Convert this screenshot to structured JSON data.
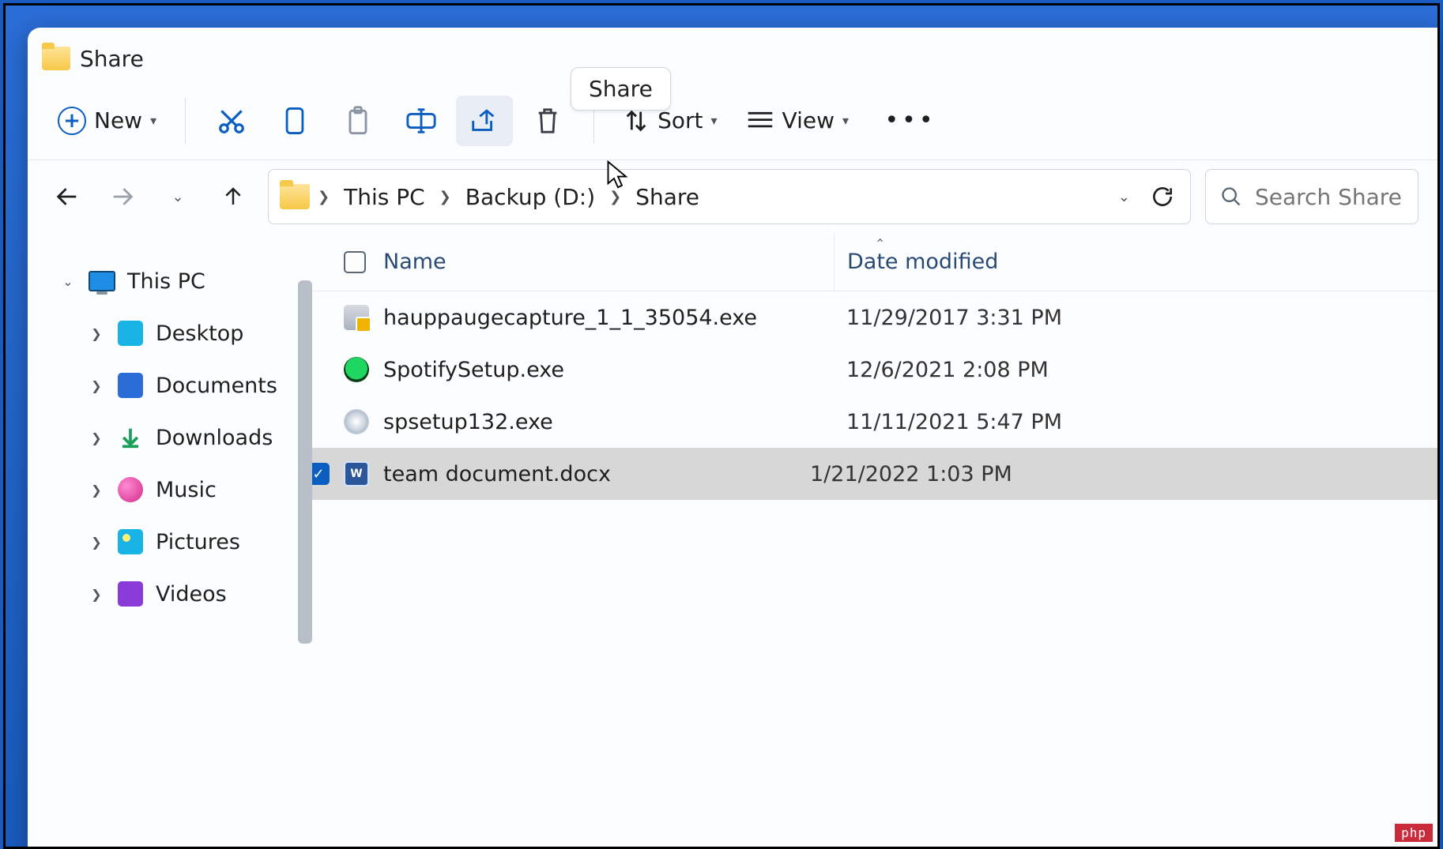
{
  "window": {
    "title": "Share"
  },
  "tooltip": {
    "share": "Share"
  },
  "toolbar": {
    "new_label": "New",
    "sort_label": "Sort",
    "view_label": "View"
  },
  "breadcrumb": {
    "items": [
      "This PC",
      "Backup (D:)",
      "Share"
    ]
  },
  "search": {
    "placeholder": "Search Share"
  },
  "sidebar": {
    "root": "This PC",
    "items": [
      {
        "label": "Desktop"
      },
      {
        "label": "Documents"
      },
      {
        "label": "Downloads"
      },
      {
        "label": "Music"
      },
      {
        "label": "Pictures"
      },
      {
        "label": "Videos"
      }
    ]
  },
  "columns": {
    "name": "Name",
    "date": "Date modified"
  },
  "files": [
    {
      "name": "hauppaugecapture_1_1_35054.exe",
      "modified": "11/29/2017 3:31 PM",
      "icon": "exe",
      "selected": false
    },
    {
      "name": "SpotifySetup.exe",
      "modified": "12/6/2021 2:08 PM",
      "icon": "spotify",
      "selected": false
    },
    {
      "name": "spsetup132.exe",
      "modified": "11/11/2021 5:47 PM",
      "icon": "disc",
      "selected": false
    },
    {
      "name": "team document.docx",
      "modified": "1/21/2022 1:03 PM",
      "icon": "word",
      "selected": true
    }
  ],
  "watermark": "php"
}
